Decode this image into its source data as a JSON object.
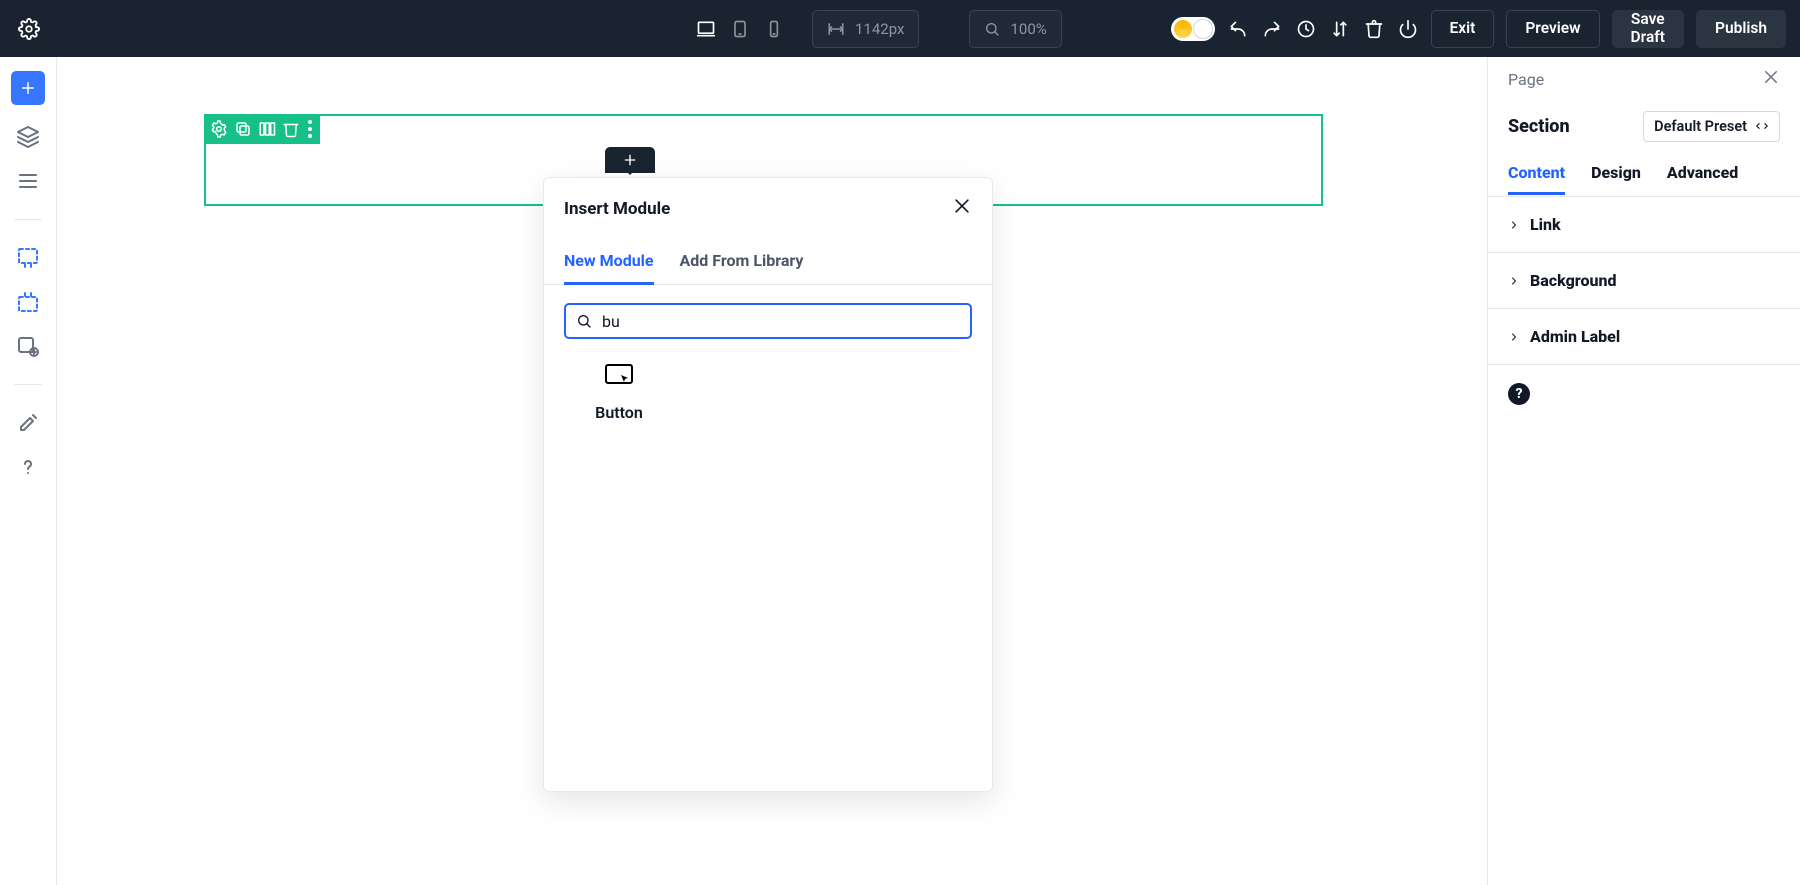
{
  "topbar": {
    "width_label": "1142px",
    "zoom_label": "100%",
    "exit": "Exit",
    "preview": "Preview",
    "save_draft": "Save\nDraft",
    "publish": "Publish"
  },
  "popover": {
    "title": "Insert Module",
    "tabs": {
      "new": "New Module",
      "library": "Add From Library"
    },
    "search_value": "bu",
    "results": [
      {
        "label": "Button"
      }
    ]
  },
  "right_panel": {
    "page_label": "Page",
    "section_label": "Section",
    "preset_label": "Default Preset",
    "tabs": {
      "content": "Content",
      "design": "Design",
      "advanced": "Advanced"
    },
    "groups": [
      "Link",
      "Background",
      "Admin Label"
    ],
    "help": "?"
  }
}
